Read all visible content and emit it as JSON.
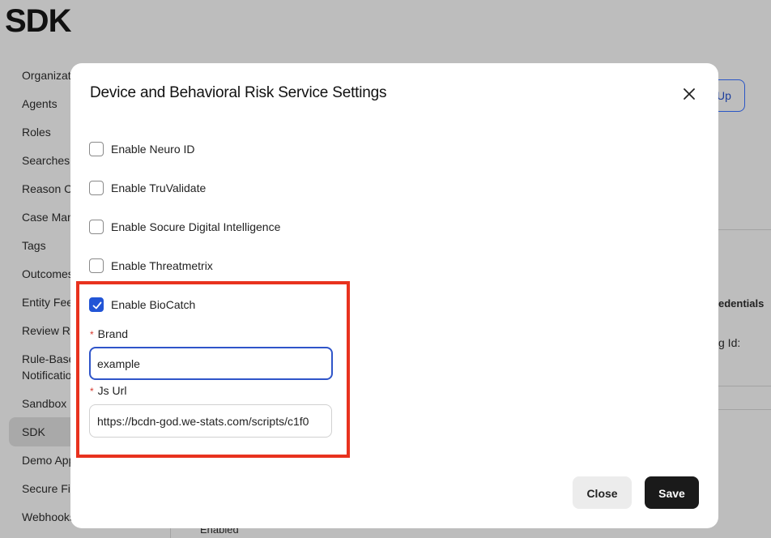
{
  "page": {
    "title": "SDK",
    "header_button_label": "Up",
    "right_panel": {
      "credentials_label": "edentials",
      "id_label": "g Id:",
      "status_label": "Enabled"
    }
  },
  "sidebar": {
    "items": [
      {
        "label": "Organizat"
      },
      {
        "label": "Agents"
      },
      {
        "label": "Roles"
      },
      {
        "label": "Searches"
      },
      {
        "label": "Reason C"
      },
      {
        "label": "Case Man"
      },
      {
        "label": "Tags"
      },
      {
        "label": "Outcomes"
      },
      {
        "label": "Entity Fee"
      },
      {
        "label": "Review Re"
      },
      {
        "label": "Rule-Base"
      },
      {
        "label": "Notificatio"
      },
      {
        "label": "Sandbox I"
      },
      {
        "label": "SDK"
      },
      {
        "label": "Demo App"
      },
      {
        "label": "Secure Fil"
      },
      {
        "label": "Webhooks"
      }
    ],
    "active_item": "SDK"
  },
  "modal": {
    "title": "Device and Behavioral Risk Service Settings",
    "close_icon": "close-icon",
    "options": [
      {
        "label": "Enable Neuro ID",
        "checked": false
      },
      {
        "label": "Enable TruValidate",
        "checked": false
      },
      {
        "label": "Enable Socure Digital Intelligence",
        "checked": false
      },
      {
        "label": "Enable Threatmetrix",
        "checked": false
      },
      {
        "label": "Enable BioCatch",
        "checked": true
      }
    ],
    "brand": {
      "label": "Brand",
      "required_marker": "*",
      "value": "example"
    },
    "js_url": {
      "label": "Js Url",
      "required_marker": "*",
      "value": "https://bcdn-god.we-stats.com/scripts/c1f0"
    },
    "close_label": "Close",
    "save_label": "Save"
  },
  "colors": {
    "accent": "#2255d6",
    "highlight": "#e8321e",
    "primary_button": "#1a1a1a"
  }
}
